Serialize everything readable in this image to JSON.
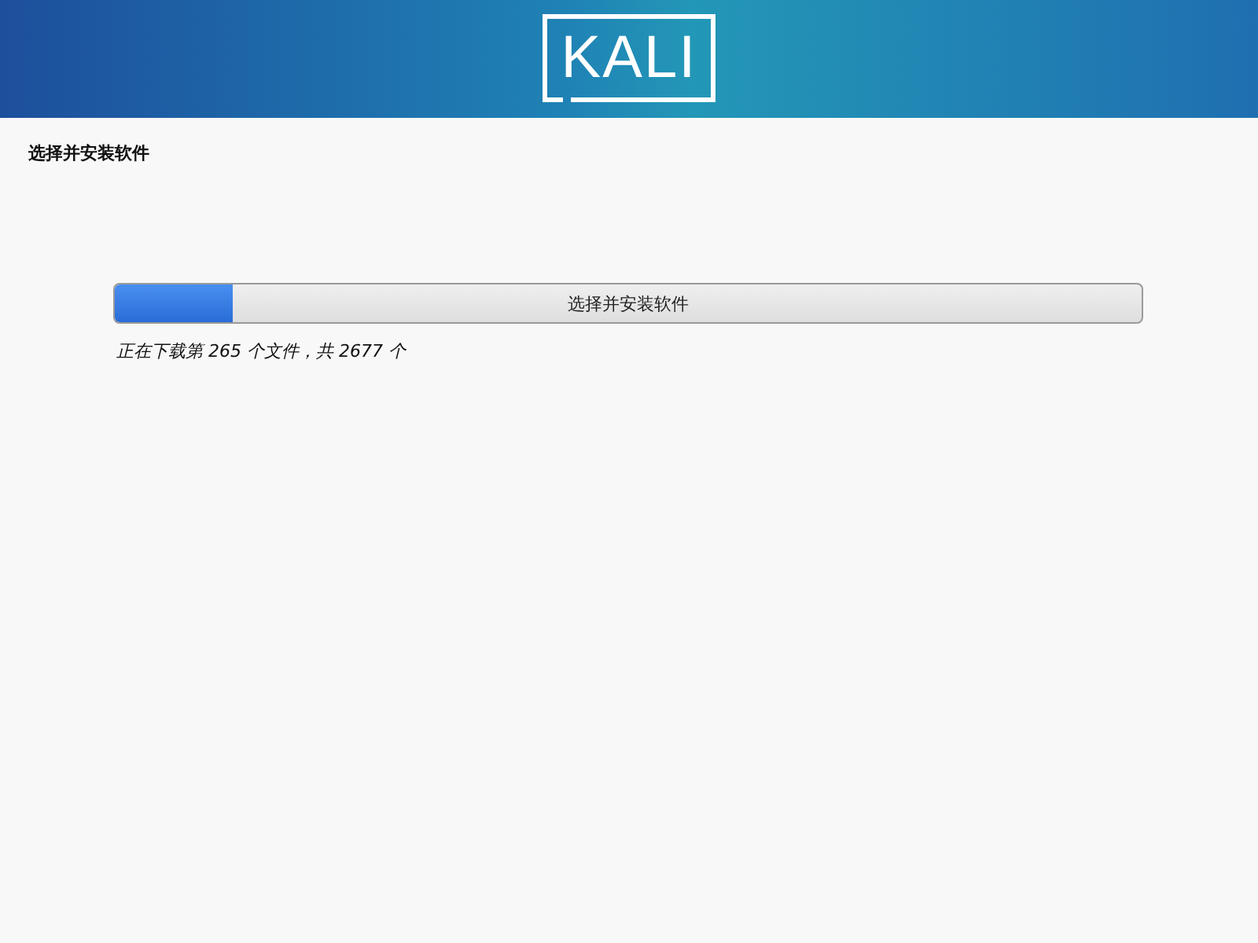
{
  "header": {
    "logo": "KALI"
  },
  "page_title": "选择并安装软件",
  "progress": {
    "label": "选择并安装软件",
    "level": 0.115,
    "status": "正在下载第 265 个文件，共 2677 个"
  }
}
